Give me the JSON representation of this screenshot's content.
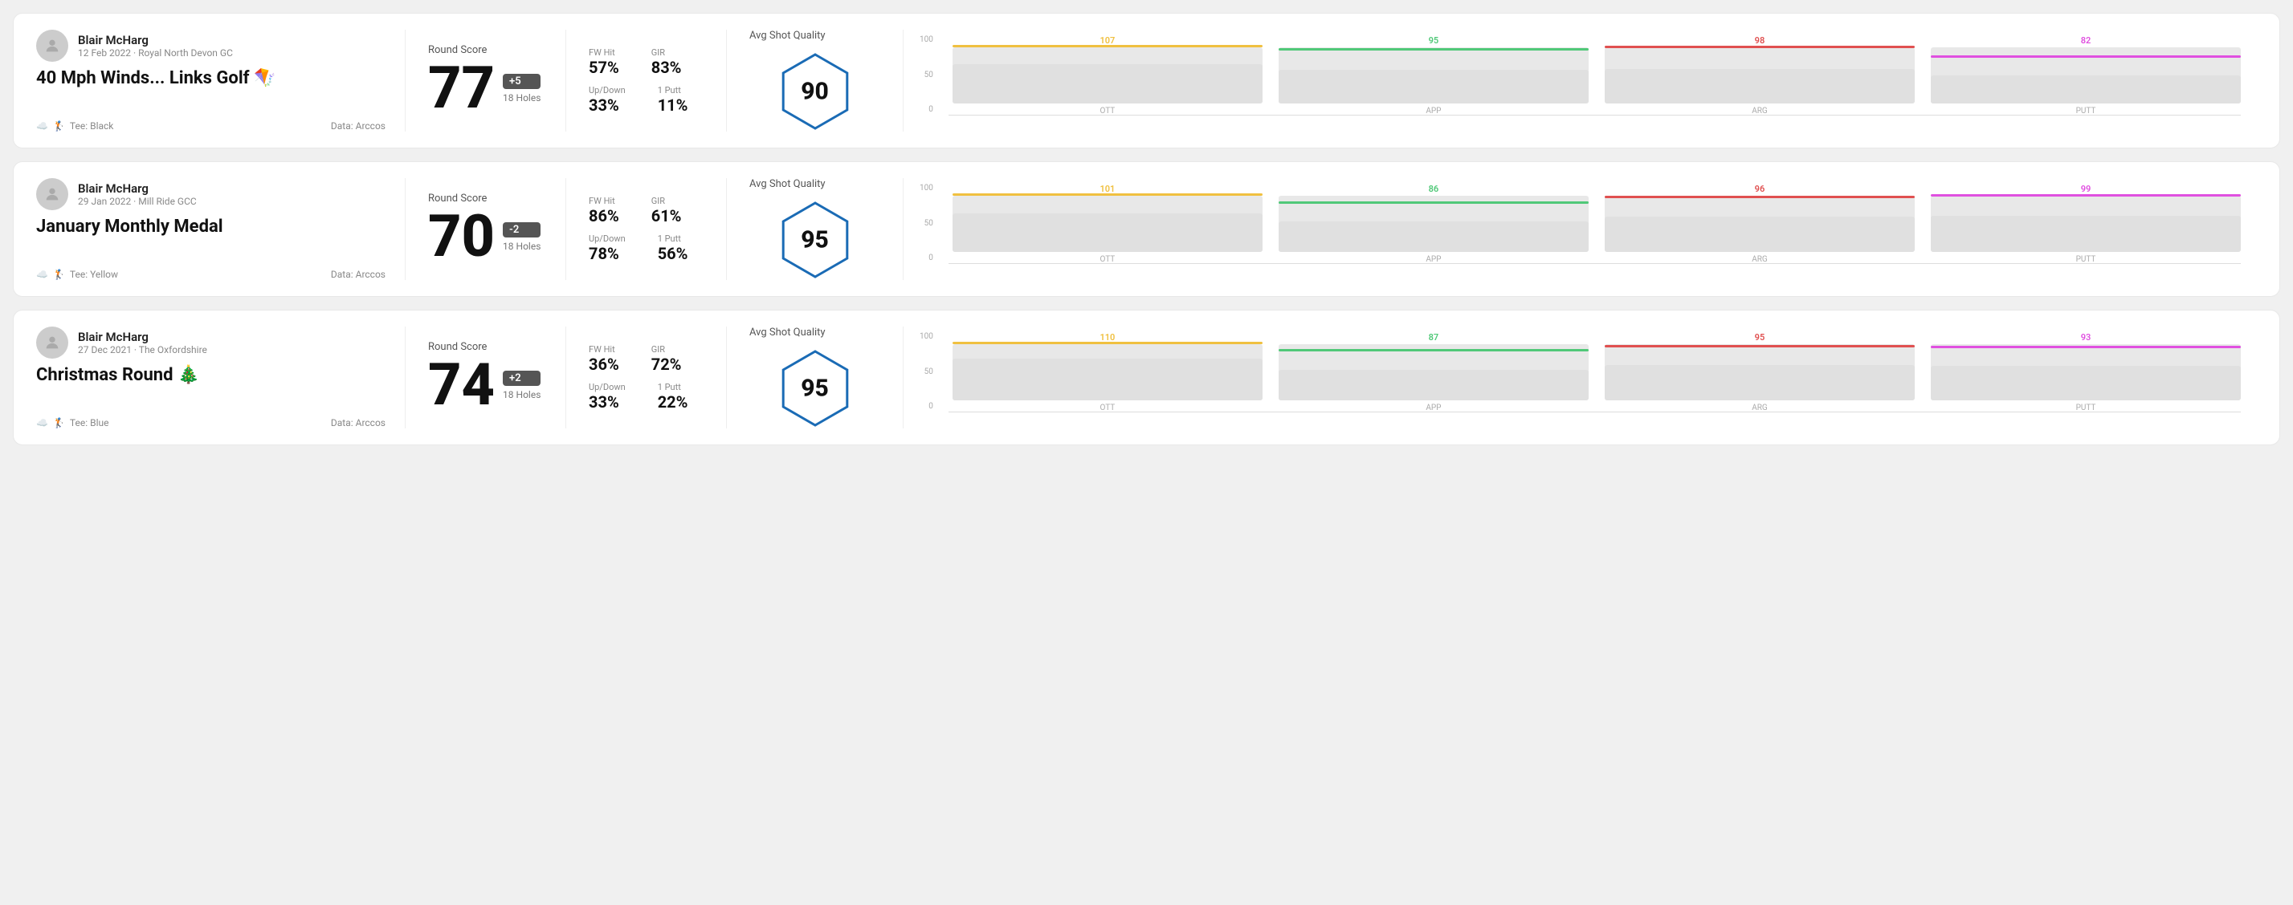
{
  "rounds": [
    {
      "id": "round1",
      "player_name": "Blair McHarg",
      "date_course": "12 Feb 2022 · Royal North Devon GC",
      "title": "40 Mph Winds... Links Golf 🪁",
      "tee": "Black",
      "data_source": "Data: Arccos",
      "score": "77",
      "score_diff": "+5",
      "score_diff_positive": true,
      "holes": "18 Holes",
      "fw_hit": "57%",
      "gir": "83%",
      "up_down": "33%",
      "one_putt": "11%",
      "avg_quality": "90",
      "chart": {
        "y_labels": [
          "100",
          "50",
          "0"
        ],
        "columns": [
          {
            "label": "OTT",
            "value": 107,
            "color": "#f0c040",
            "bar_height_pct": 70
          },
          {
            "label": "APP",
            "value": 95,
            "color": "#50c878",
            "bar_height_pct": 60
          },
          {
            "label": "ARG",
            "value": 98,
            "color": "#e05050",
            "bar_height_pct": 62
          },
          {
            "label": "PUTT",
            "value": 82,
            "color": "#e050e0",
            "bar_height_pct": 50
          }
        ]
      }
    },
    {
      "id": "round2",
      "player_name": "Blair McHarg",
      "date_course": "29 Jan 2022 · Mill Ride GCC",
      "title": "January Monthly Medal",
      "tee": "Yellow",
      "data_source": "Data: Arccos",
      "score": "70",
      "score_diff": "-2",
      "score_diff_positive": false,
      "holes": "18 Holes",
      "fw_hit": "86%",
      "gir": "61%",
      "up_down": "78%",
      "one_putt": "56%",
      "avg_quality": "95",
      "chart": {
        "y_labels": [
          "100",
          "50",
          "0"
        ],
        "columns": [
          {
            "label": "OTT",
            "value": 101,
            "color": "#f0c040",
            "bar_height_pct": 68
          },
          {
            "label": "APP",
            "value": 86,
            "color": "#50c878",
            "bar_height_pct": 54
          },
          {
            "label": "ARG",
            "value": 96,
            "color": "#e05050",
            "bar_height_pct": 63
          },
          {
            "label": "PUTT",
            "value": 99,
            "color": "#e050e0",
            "bar_height_pct": 65
          }
        ]
      }
    },
    {
      "id": "round3",
      "player_name": "Blair McHarg",
      "date_course": "27 Dec 2021 · The Oxfordshire",
      "title": "Christmas Round 🎄",
      "tee": "Blue",
      "data_source": "Data: Arccos",
      "score": "74",
      "score_diff": "+2",
      "score_diff_positive": true,
      "holes": "18 Holes",
      "fw_hit": "36%",
      "gir": "72%",
      "up_down": "33%",
      "one_putt": "22%",
      "avg_quality": "95",
      "chart": {
        "y_labels": [
          "100",
          "50",
          "0"
        ],
        "columns": [
          {
            "label": "OTT",
            "value": 110,
            "color": "#f0c040",
            "bar_height_pct": 74
          },
          {
            "label": "APP",
            "value": 87,
            "color": "#50c878",
            "bar_height_pct": 55
          },
          {
            "label": "ARG",
            "value": 95,
            "color": "#e05050",
            "bar_height_pct": 63
          },
          {
            "label": "PUTT",
            "value": 93,
            "color": "#e050e0",
            "bar_height_pct": 61
          }
        ]
      }
    }
  ],
  "labels": {
    "round_score": "Round Score",
    "fw_hit": "FW Hit",
    "gir": "GIR",
    "up_down": "Up/Down",
    "one_putt": "1 Putt",
    "avg_quality": "Avg Shot Quality",
    "tee_prefix": "Tee:"
  }
}
